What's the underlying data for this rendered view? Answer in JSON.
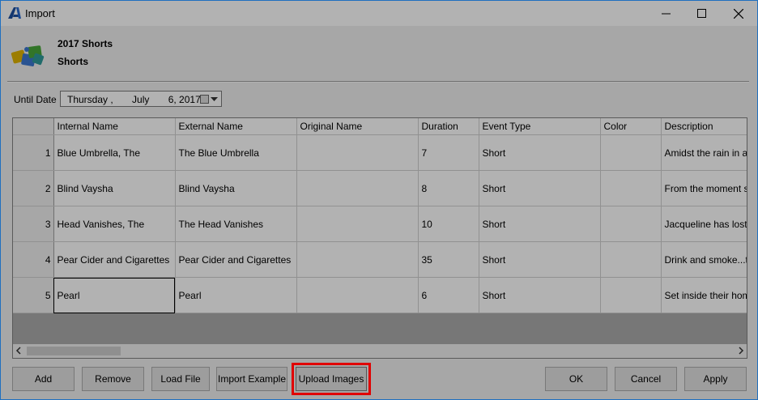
{
  "window": {
    "title": "Import",
    "app_icon": "app-logo-icon",
    "controls": [
      "minimize-icon",
      "maximize-icon",
      "close-icon"
    ]
  },
  "header": {
    "line1": "2017 Shorts",
    "line2": "Shorts",
    "icon": "puzzle-pieces-icon"
  },
  "until_date": {
    "label": "Until Date",
    "value": "Thursday ,       July       6, 2017"
  },
  "table": {
    "columns": [
      "Internal Name",
      "External Name",
      "Original Name",
      "Duration",
      "Event Type",
      "Color",
      "Description"
    ],
    "rows": [
      {
        "num": "1",
        "internal": "Blue Umbrella, The",
        "external": "The Blue Umbrella",
        "original": "",
        "duration": "7",
        "event_type": "Short",
        "color": "",
        "description": "Amidst the rain in a s"
      },
      {
        "num": "2",
        "internal": "Blind Vaysha",
        "external": "Blind Vaysha",
        "original": "",
        "duration": "8",
        "event_type": "Short",
        "color": "",
        "description": "From the moment she"
      },
      {
        "num": "3",
        "internal": "Head Vanishes, The",
        "external": "The Head Vanishes",
        "original": "",
        "duration": "10",
        "event_type": "Short",
        "color": "",
        "description": "Jacqueline has lost h"
      },
      {
        "num": "4",
        "internal": "Pear Cider and Cigarettes",
        "external": "Pear Cider and Cigarettes",
        "original": "",
        "duration": "35",
        "event_type": "Short",
        "color": "",
        "description": "Drink and smoke...th"
      },
      {
        "num": "5",
        "internal": "Pearl",
        "external": "Pearl",
        "original": "",
        "duration": "6",
        "event_type": "Short",
        "color": "",
        "description": "Set inside their home"
      }
    ]
  },
  "buttons": {
    "add": "Add",
    "remove": "Remove",
    "load_file": "Load File",
    "import_example": "Import Example",
    "upload_images": "Upload Images",
    "ok": "OK",
    "cancel": "Cancel",
    "apply": "Apply"
  },
  "colors": {
    "highlight": "#e00000",
    "window_bg": "#f0f0f0",
    "overlay": "#000000"
  }
}
